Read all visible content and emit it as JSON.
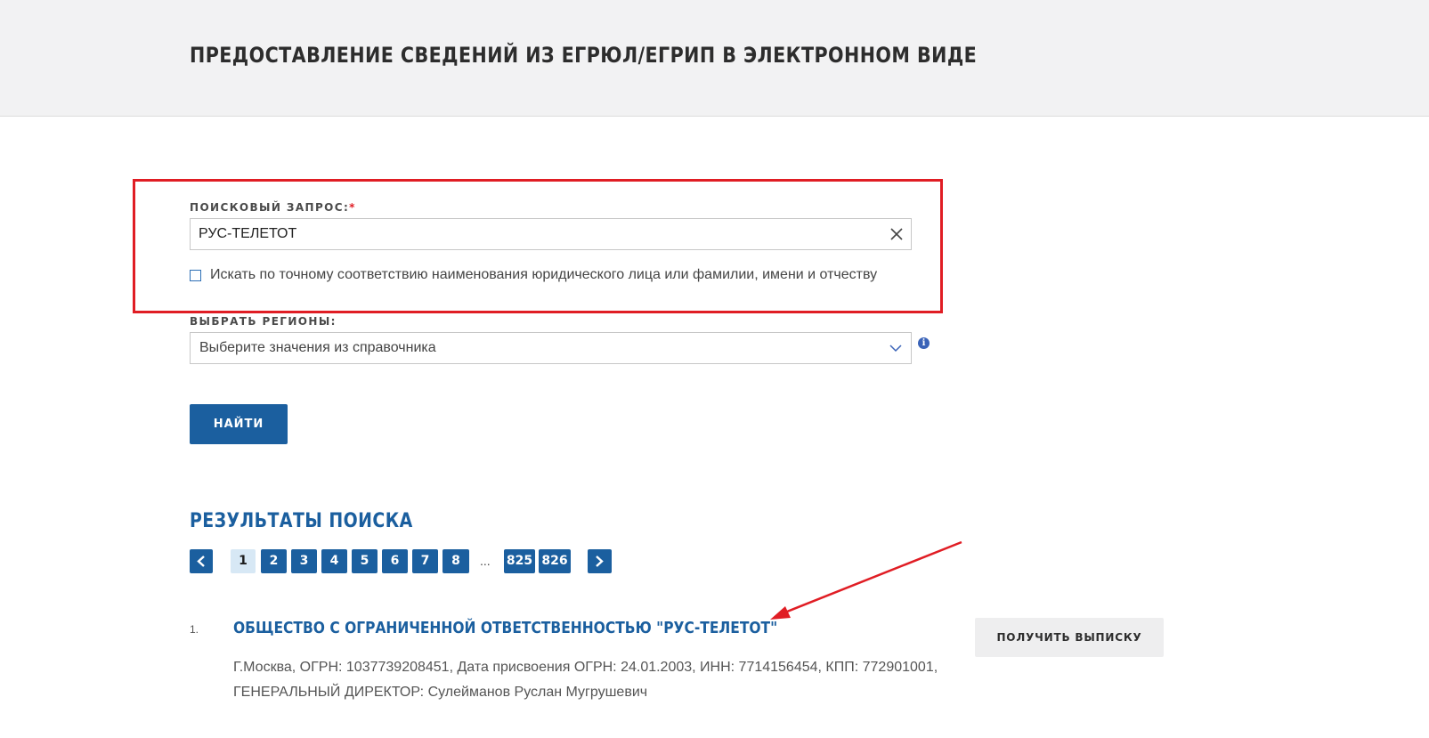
{
  "header": {
    "title": "ПРЕДОСТАВЛЕНИЕ СВЕДЕНИЙ ИЗ ЕГРЮЛ/ЕГРИП В ЭЛЕКТРОННОМ ВИДЕ"
  },
  "search": {
    "label": "ПОИСКОВЫЙ ЗАПРОС:",
    "required_mark": "*",
    "value": "РУС-ТЕЛЕТОТ",
    "exact_match_label": "Искать по точному соответствию наименования юридического лица или фамилии, имени и отчеству",
    "exact_match_checked": false
  },
  "regions": {
    "label": "ВЫБРАТЬ РЕГИОНЫ:",
    "placeholder": "Выберите значения из справочника"
  },
  "find_button": {
    "label": "НАЙТИ"
  },
  "results": {
    "title": "РЕЗУЛЬТАТЫ ПОИСКА",
    "pagination": {
      "current": "1",
      "pages": [
        "1",
        "2",
        "3",
        "4",
        "5",
        "6",
        "7",
        "8"
      ],
      "ellipsis": "...",
      "last_pages": [
        "825",
        "826"
      ]
    },
    "items": [
      {
        "number": "1.",
        "title": "ОБЩЕСТВО С ОГРАНИЧЕННОЙ ОТВЕТСТВЕННОСТЬЮ \"РУС-ТЕЛЕТОТ\"",
        "details": "Г.Москва, ОГРН: 1037739208451, Дата присвоения ОГРН: 24.01.2003, ИНН: 7714156454, КПП: 772901001, ГЕНЕРАЛЬНЫЙ ДИРЕКТОР: Сулейманов Руслан Мугрушевич",
        "button_label": "ПОЛУЧИТЬ ВЫПИСКУ"
      }
    ]
  },
  "colors": {
    "brand_blue": "#1b5f9f",
    "annotation_red": "#e01d24",
    "header_bg": "#f2f2f3"
  }
}
